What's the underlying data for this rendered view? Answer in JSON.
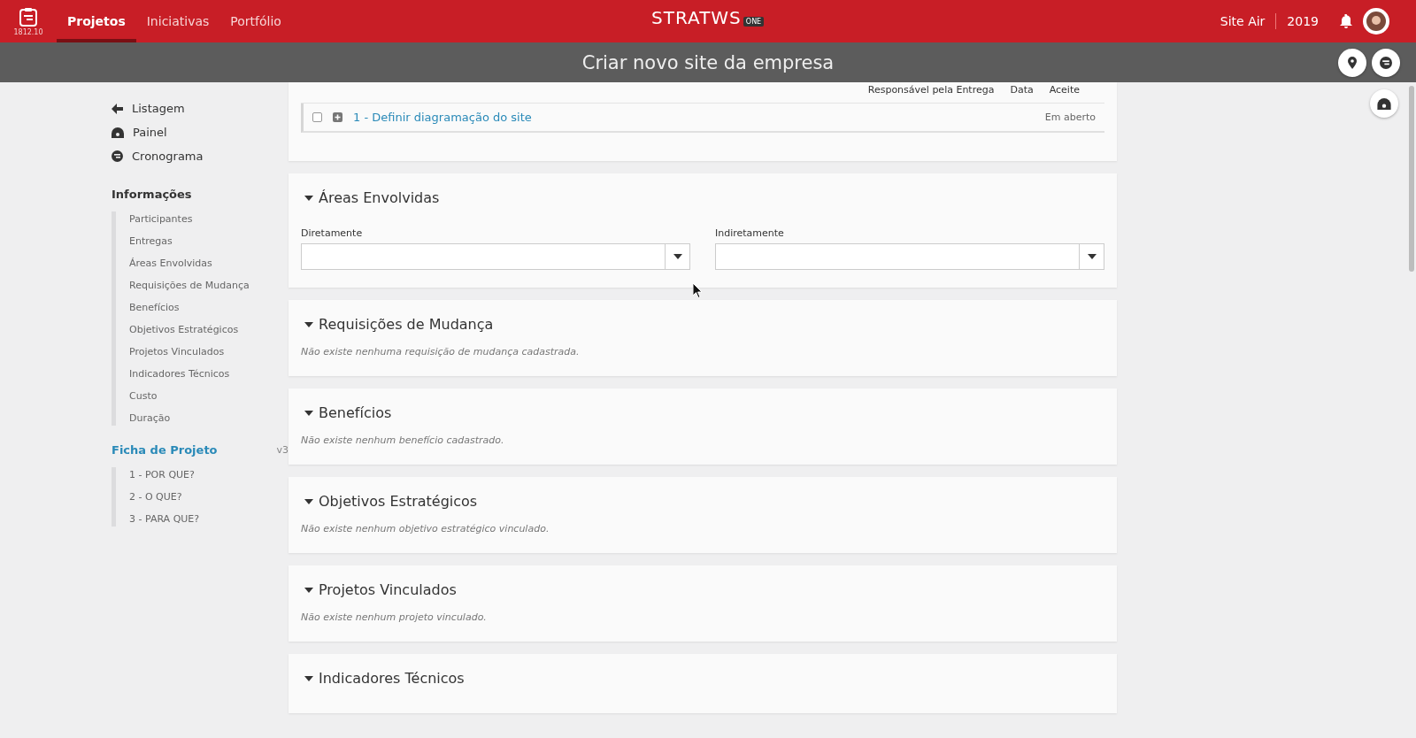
{
  "topbar": {
    "version": "1812.10",
    "nav": [
      {
        "label": "Projetos",
        "selected": true
      },
      {
        "label": "Iniciativas",
        "selected": false
      },
      {
        "label": "Portfólio",
        "selected": false
      }
    ],
    "logo": {
      "word": "STRATWS",
      "badge": "ONE"
    },
    "company": "Site Air",
    "year": "2019"
  },
  "title": "Criar novo site da empresa",
  "sidebar": {
    "links": [
      {
        "label": "Listagem",
        "kind": "back"
      },
      {
        "label": "Painel",
        "kind": "dashboard"
      },
      {
        "label": "Cronograma",
        "kind": "schedule"
      }
    ],
    "info_heading": "Informações",
    "info_items": [
      "Participantes",
      "Entregas",
      "Áreas Envolvidas",
      "Requisições de Mudança",
      "Benefícios",
      "Objetivos Estratégicos",
      "Projetos Vinculados",
      "Indicadores Técnicos",
      "Custo",
      "Duração"
    ],
    "ficha_heading": "Ficha de Projeto",
    "ficha_version": "v3",
    "ficha_items": [
      "1 - POR QUE?",
      "2 - O QUE?",
      "3 - PARA QUE?"
    ]
  },
  "sections": [
    {
      "kind": "deliveries",
      "columns": [
        "Responsável pela Entrega",
        "Data",
        "Aceite"
      ],
      "rows": [
        {
          "title": "1 - Definir diagramação do site",
          "checked": false,
          "status": "Em aberto"
        }
      ]
    },
    {
      "kind": "areas",
      "heading": "Áreas Envolvidas",
      "fields": [
        {
          "label": "Diretamente"
        },
        {
          "label": "Indiretamente"
        }
      ]
    },
    {
      "kind": "empty",
      "heading": "Requisições de Mudança",
      "message": "Não existe nenhuma requisição de mudança cadastrada."
    },
    {
      "kind": "empty",
      "heading": "Benefícios",
      "message": "Não existe nenhum benefício cadastrado."
    },
    {
      "kind": "empty",
      "heading": "Objetivos Estratégicos",
      "message": "Não existe nenhum objetivo estratégico vinculado."
    },
    {
      "kind": "empty",
      "heading": "Projetos Vinculados",
      "message": "Não existe nenhum projeto vinculado."
    },
    {
      "kind": "heading",
      "heading": "Indicadores Técnicos"
    }
  ]
}
